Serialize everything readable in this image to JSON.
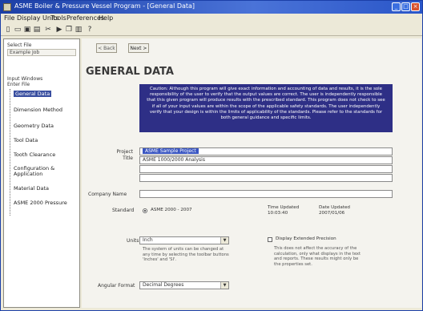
{
  "window": {
    "title": "ASME Boiler & Pressure Vessel Program - [General Data]",
    "controls": [
      "minimize",
      "maximize",
      "close"
    ]
  },
  "menu": [
    "File",
    "Display Units",
    "Tools",
    "Preferences",
    "Help"
  ],
  "toolbar": {
    "icons": [
      "new-file-icon",
      "open-file-icon",
      "save-icon",
      "print-icon",
      "cut-icon",
      "run-icon",
      "copy-icon",
      "paste-icon",
      "help-icon"
    ]
  },
  "sidebar": {
    "job_label": "Select File",
    "job_value": "Example Job",
    "section_label": "Input Windows",
    "section_value": "Enter File",
    "tree": [
      "General Data",
      "Dimension Method",
      "Geometry Data",
      "Tool Data",
      "Tooth Clearance",
      "Configuration & Application",
      "Material Data",
      "ASME 2000 Pressure"
    ],
    "selected_index": 0
  },
  "main": {
    "nav_back": "< Back",
    "nav_next": "Next >",
    "heading": "GENERAL DATA",
    "caution": "Caution: Although this program will give exact information and accounting of data and results, it is the sole responsibility of the user to verify that the output values are correct. The user is independently responsible that this given program will produce results with the prescribed standard. This program does not check to see if all of your input values are within the scope of the applicable safety standards. The user independently verify that your design is within the limits of applicability of the standards. Please refer to the standards for both general guidance and specific limits.",
    "project_title_label": "Project Title",
    "project_title_lines": [
      "ASME Sample Project",
      "ASME 1000/2000 Analysis",
      "",
      ""
    ],
    "company_label": "Company Name",
    "company_value": "",
    "standard_label": "Standard",
    "standard_value": "ASME 2000 - 2007",
    "time_updated_label": "Time Updated",
    "time_updated_value": "10:03:40",
    "date_updated_label": "Date Updated",
    "date_updated_value": "2007/01/06",
    "units_label": "Units",
    "units_value": "Inch",
    "units_note": "The system of units can be changed at any time by selecting the toolbar buttons 'Inches' and 'SI'.",
    "display_extended_label": "Display Extended Precision",
    "display_extended_checked": false,
    "display_extended_note": "This does not affect the accuracy of the calculation, only what displays in the text and reports. These results might only be the properties set.",
    "angular_label": "Angular Format",
    "angular_value": "Decimal Degrees"
  },
  "colors": {
    "titlebar": "#1c3fa6",
    "caution_bg": "#2e2f86",
    "selection": "#3a56c2"
  }
}
